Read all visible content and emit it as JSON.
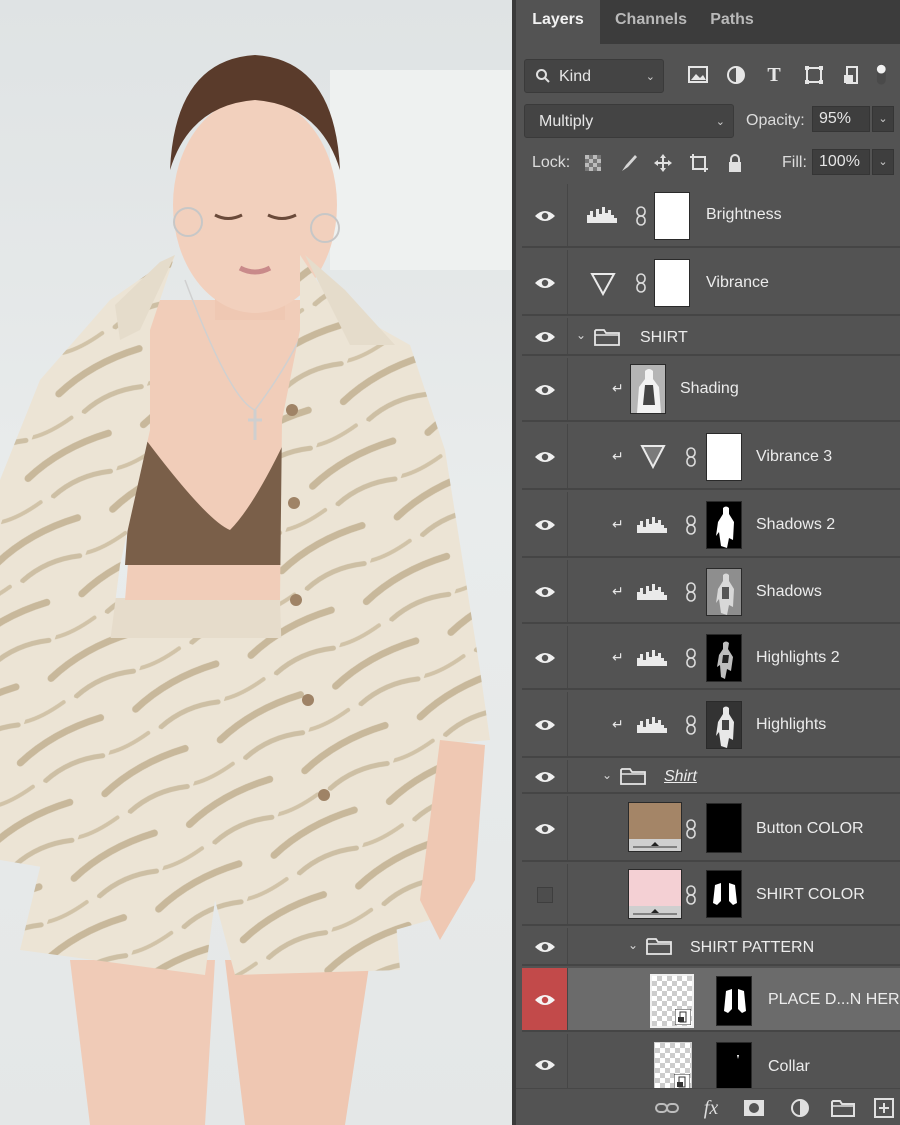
{
  "tabs": [
    {
      "label": "Layers",
      "active": true
    },
    {
      "label": "Channels",
      "active": false
    },
    {
      "label": "Paths",
      "active": false
    }
  ],
  "filter": {
    "kind_label": "Kind",
    "icons": [
      "image-filter-icon",
      "adjustment-filter-icon",
      "type-filter-icon",
      "shape-filter-icon",
      "smart-object-filter-icon",
      "filter-toggle-icon"
    ]
  },
  "blend": {
    "mode": "Multiply",
    "opacity_label": "Opacity:",
    "opacity_value": "95%",
    "lock_label": "Lock:",
    "fill_label": "Fill:",
    "fill_value": "100%"
  },
  "layers": [
    {
      "name": "Brightness",
      "visible": true,
      "type": "levels-adjustment",
      "clipped": false,
      "mask": "white"
    },
    {
      "name": "Vibrance",
      "visible": true,
      "type": "vibrance-adjustment",
      "clipped": false,
      "mask": "white"
    },
    {
      "name": "SHIRT",
      "visible": true,
      "type": "group",
      "expanded": true
    },
    {
      "name": "Shading",
      "visible": true,
      "type": "pixel",
      "clipped": true
    },
    {
      "name": "Vibrance 3",
      "visible": true,
      "type": "vibrance-adjustment",
      "clipped": true,
      "mask": "white"
    },
    {
      "name": "Shadows 2",
      "visible": true,
      "type": "levels-adjustment",
      "clipped": true,
      "mask": "figure-dark"
    },
    {
      "name": "Shadows",
      "visible": true,
      "type": "levels-adjustment",
      "clipped": true,
      "mask": "figure-gray"
    },
    {
      "name": "Highlights 2",
      "visible": true,
      "type": "levels-adjustment",
      "clipped": true,
      "mask": "figure-dark"
    },
    {
      "name": "Highlights",
      "visible": true,
      "type": "levels-adjustment",
      "clipped": true,
      "mask": "figure-gray"
    },
    {
      "name": "Shirt",
      "visible": true,
      "type": "group",
      "expanded": true,
      "underlined": true
    },
    {
      "name": "Button COLOR",
      "visible": true,
      "type": "solid-fill",
      "fill_color": "#a48567",
      "mask": "black"
    },
    {
      "name": "SHIRT COLOR",
      "visible": false,
      "type": "solid-fill",
      "fill_color": "#f4d0d4",
      "mask": "shirt-shape"
    },
    {
      "name": "SHIRT PATTERN",
      "visible": true,
      "type": "group",
      "expanded": true
    },
    {
      "name": "PLACE D...N HERE",
      "visible": true,
      "type": "smart-object",
      "selected": true,
      "mask": "shirt-shape"
    },
    {
      "name": "Collar",
      "visible": true,
      "type": "smart-object",
      "mask": "collar-shape"
    }
  ],
  "bottom_icons": [
    "link-layers-icon",
    "fx-icon",
    "add-mask-icon",
    "new-adjustment-icon",
    "new-group-icon",
    "new-layer-icon"
  ],
  "colors": {
    "panel_bg": "#535353",
    "tabbar_bg": "#3c3c3c",
    "selected_row": "#6b6b6b",
    "selected_eye": "#c24a4a",
    "button_color": "#a48567",
    "shirt_color": "#f4d0d4"
  }
}
